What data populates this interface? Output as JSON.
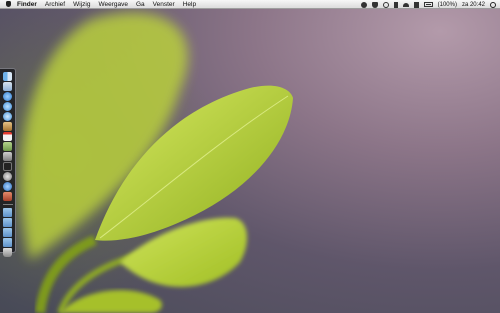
{
  "menubar": {
    "app": "Finder",
    "items": [
      "Archief",
      "Wijzig",
      "Weergave",
      "Ga",
      "Venster",
      "Help"
    ],
    "status": {
      "battery": "(100%)",
      "clock": "za 20:42"
    }
  },
  "dock": {
    "apps": [
      {
        "icon": "finder-icon",
        "color": "#4a8fd6"
      },
      {
        "icon": "mail-icon",
        "color": "#8fb0d8"
      },
      {
        "icon": "safari-icon",
        "color": "#3a8ad9"
      },
      {
        "icon": "ichat-icon",
        "color": "#58a6e6"
      },
      {
        "icon": "itunes-icon",
        "color": "#4aa3e0"
      },
      {
        "icon": "address-book-icon",
        "color": "#c89a5a"
      },
      {
        "icon": "ical-icon",
        "color": "#e0e0e0"
      },
      {
        "icon": "preview-icon",
        "color": "#7aa55c"
      },
      {
        "icon": "iphoto-icon",
        "color": "#9a9a9a"
      },
      {
        "icon": "terminal-icon",
        "color": "#333333"
      },
      {
        "icon": "system-preferences-icon",
        "color": "#8c8c8c"
      },
      {
        "icon": "quicktime-icon",
        "color": "#3b7fcf"
      },
      {
        "icon": "photo-booth-icon",
        "color": "#c0573e"
      }
    ],
    "stacks": [
      {
        "icon": "applications-folder-icon"
      },
      {
        "icon": "documents-folder-icon"
      },
      {
        "icon": "downloads-folder-icon"
      },
      {
        "icon": "home-folder-icon"
      }
    ],
    "trash": {
      "icon": "trash-icon"
    }
  },
  "wallpaper": {
    "colors": {
      "leaf": "#b8cf3a",
      "background": "#5f566a"
    }
  }
}
